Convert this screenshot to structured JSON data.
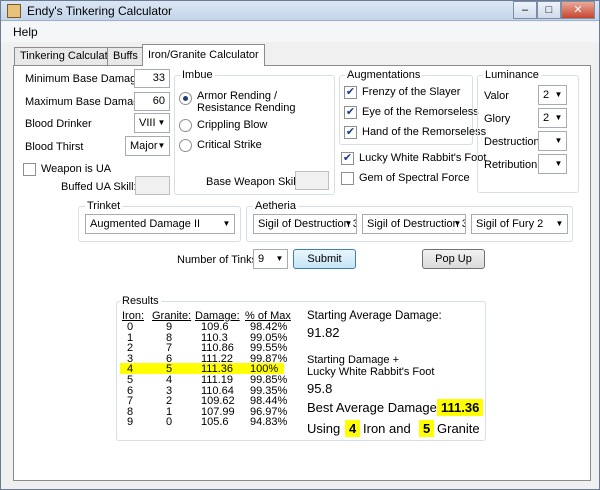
{
  "window": {
    "title": "Endy's Tinkering Calculator",
    "controls": [
      "–",
      "□",
      "✕"
    ]
  },
  "menu": {
    "help": "Help"
  },
  "tabs": [
    "Tinkering Calculator",
    "Buffs",
    "Iron/Granite Calculator"
  ],
  "weapon": {
    "min_base_damage_label": "Minimum Base Damage:",
    "min_base_damage": "33",
    "max_base_damage_label": "Maximum Base Damage:",
    "max_base_damage": "60",
    "blood_drinker_label": "Blood Drinker",
    "blood_drinker": "VIII",
    "blood_thirst_label": "Blood Thirst",
    "blood_thirst": "Major",
    "weapon_is_ua_label": "Weapon is UA",
    "buffed_ua_skill_label": "Buffed UA Skill:",
    "buffed_ua_skill": ""
  },
  "imbue": {
    "title": "Imbue",
    "options": [
      "Armor Rending /\nResistance Rending",
      "Crippling Blow",
      "Critical Strike"
    ],
    "selected_index": 0,
    "base_weapon_skill_label": "Base Weapon Skill:",
    "base_weapon_skill": ""
  },
  "augmentations": {
    "title": "Augmentations",
    "items": [
      {
        "label": "Frenzy of the Slayer",
        "checked": true
      },
      {
        "label": "Eye of the Remorseless",
        "checked": true
      },
      {
        "label": "Hand of the Remorseless",
        "checked": true
      }
    ],
    "lucky_rabbit_label": "Lucky White Rabbit's Foot",
    "lucky_rabbit_checked": true,
    "gem_label": "Gem of Spectral Force",
    "gem_checked": false
  },
  "luminance": {
    "title": "Luminance",
    "valor_label": "Valor",
    "valor": "2",
    "glory_label": "Glory",
    "glory": "2",
    "destruction_label": "Destruction",
    "destruction": "",
    "retribution_label": "Retribution",
    "retribution": ""
  },
  "trinket": {
    "title": "Trinket",
    "value": "Augmented Damage II"
  },
  "aetheria": {
    "title": "Aetheria",
    "slots": [
      "Sigil of Destruction 3",
      "Sigil of Destruction 3",
      "Sigil of Fury 2"
    ]
  },
  "tinks": {
    "label": "Number of Tinks",
    "value": "9",
    "submit_label": "Submit",
    "popup_label": "Pop Up"
  },
  "results": {
    "title": "Results",
    "headers": [
      "Iron:",
      "Granite:",
      "Damage:",
      "% of Max"
    ],
    "rows": [
      [
        "0",
        "9",
        "109.6",
        "98.42%"
      ],
      [
        "1",
        "8",
        "110.3",
        "99.05%"
      ],
      [
        "2",
        "7",
        "110.86",
        "99.55%"
      ],
      [
        "3",
        "6",
        "111.22",
        "99.87%"
      ],
      [
        "4",
        "5",
        "111.36",
        "100%"
      ],
      [
        "5",
        "4",
        "111.19",
        "99.85%"
      ],
      [
        "6",
        "3",
        "110.64",
        "99.35%"
      ],
      [
        "7",
        "2",
        "109.62",
        "98.44%"
      ],
      [
        "8",
        "1",
        "107.99",
        "96.97%"
      ],
      [
        "9",
        "0",
        "105.6",
        "94.83%"
      ]
    ],
    "highlight_row": 4,
    "starting_avg_label": "Starting Average Damage:",
    "starting_avg": "91.82",
    "starting_rabbit_label_1": "Starting Damage +",
    "starting_rabbit_label_2": "Lucky White Rabbit's Foot",
    "starting_rabbit": "95.8",
    "best_label": "Best Average Damage:",
    "best_value": "111.36",
    "using_label": "Using",
    "using_iron": "4",
    "iron_and_label": "Iron and",
    "using_granite": "5",
    "granite_label": "Granite"
  },
  "colors": {
    "highlight": "#ffff00",
    "tab_active": "#ffffff",
    "window_bg": "#f0f0f0"
  }
}
